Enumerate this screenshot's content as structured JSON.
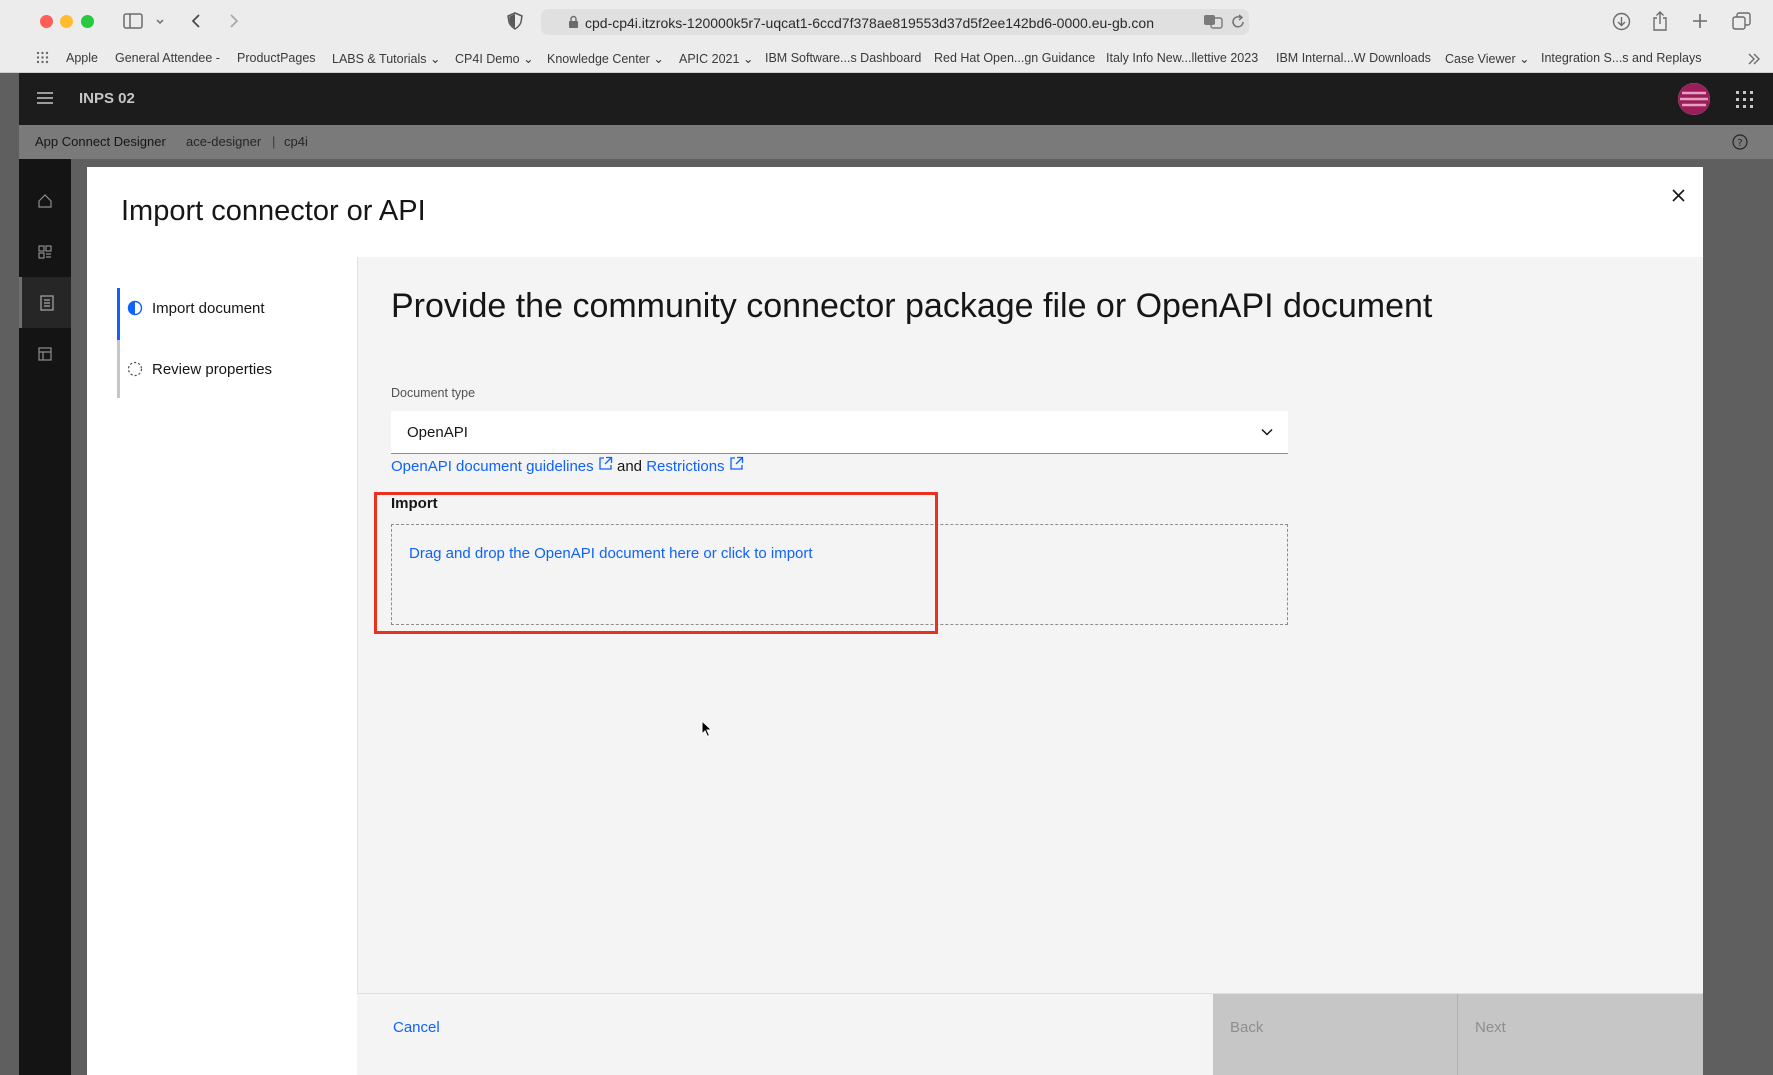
{
  "browser": {
    "url": "cpd-cp4i.itzroks-120000k5r7-uqcat1-6ccd7f378ae819553d37d5f2ee142bd6-0000.eu-gb.con",
    "bookmarks": [
      "Apple",
      "General Attendee -",
      "ProductPages",
      "LABS & Tutorials",
      "CP4I Demo",
      "Knowledge Center",
      "APIC 2021",
      "IBM Software...s Dashboard",
      "Red Hat Open...gn Guidance",
      "Italy Info New...llettive 2023",
      "IBM Internal...W Downloads",
      "Case Viewer",
      "Integration S...s and Replays"
    ]
  },
  "app": {
    "title": "INPS 02",
    "breadcrumb": [
      "App Connect Designer",
      "ace-designer",
      "cp4i"
    ],
    "rail_icons": [
      "home-icon",
      "catalog-icon",
      "document-icon",
      "dashboard-icon"
    ]
  },
  "modal": {
    "title": "Import connector or API",
    "steps": [
      {
        "label": "Import document",
        "state": "current"
      },
      {
        "label": "Review properties",
        "state": "incomplete"
      }
    ],
    "content_title": "Provide the community connector package file or OpenAPI document",
    "doctype_label": "Document type",
    "doctype_value": "OpenAPI",
    "link_guidelines": "OpenAPI document guidelines",
    "link_and": "and",
    "link_restrictions": "Restrictions",
    "import_label": "Import",
    "dropzone_text": "Drag and drop the OpenAPI document here or click to import",
    "cancel_label": "Cancel",
    "back_label": "Back",
    "next_label": "Next"
  },
  "colors": {
    "accent": "#0f62fe",
    "highlight": "#e8321e",
    "header_bg": "#1c1c1c"
  }
}
